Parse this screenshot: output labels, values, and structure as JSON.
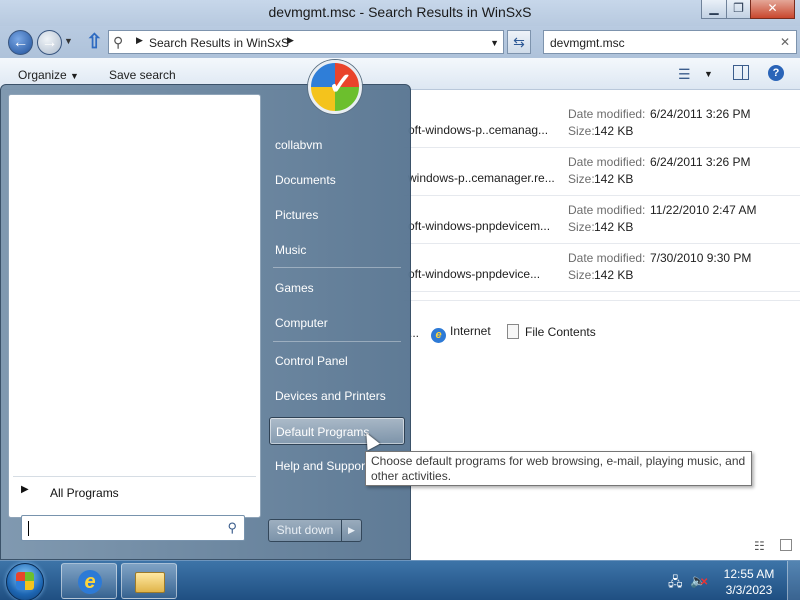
{
  "window": {
    "title": "devmgmt.msc - Search Results in WinSxS",
    "minimize_icon": "minimize-icon",
    "maximize_icon": "maximize-icon",
    "close_icon": "close-icon"
  },
  "address_bar": {
    "path": "Search Results in WinSxS",
    "search_value": "devmgmt.msc"
  },
  "toolbar": {
    "organize": "Organize",
    "save_search": "Save search"
  },
  "results": [
    {
      "name": "oft-windows-p..cemanag...",
      "date_label": "Date modified:",
      "date": "6/24/2011 3:26 PM",
      "size_label": "Size:",
      "size": "142 KB"
    },
    {
      "name": "windows-p..cemanager.re...",
      "date_label": "Date modified:",
      "date": "6/24/2011 3:26 PM",
      "size_label": "Size:",
      "size": "142 KB"
    },
    {
      "name": "oft-windows-pnpdevicem...",
      "date_label": "Date modified:",
      "date": "11/22/2010 2:47 AM",
      "size_label": "Size:",
      "size": "142 KB"
    },
    {
      "name": "oft-windows-pnpdevice...",
      "date_label": "Date modified:",
      "date": "7/30/2010 9:30 PM",
      "size_label": "Size:",
      "size": "142 KB"
    }
  ],
  "search_again": {
    "ellipsis": "...",
    "internet": "Internet",
    "file_contents": "File Contents"
  },
  "start_menu": {
    "right_items": [
      "collabvm",
      "Documents",
      "Pictures",
      "Music",
      "Games",
      "Computer",
      "Control Panel",
      "Devices and Printers",
      "Default Programs",
      "Help and Support"
    ],
    "hovered_item": "Default Programs",
    "all_programs": "All Programs",
    "shutdown": "Shut down"
  },
  "tooltip": {
    "text": "Choose default programs for web browsing, e-mail, playing music, and other activities."
  },
  "taskbar": {
    "time": "12:55 AM",
    "date": "3/3/2023"
  }
}
